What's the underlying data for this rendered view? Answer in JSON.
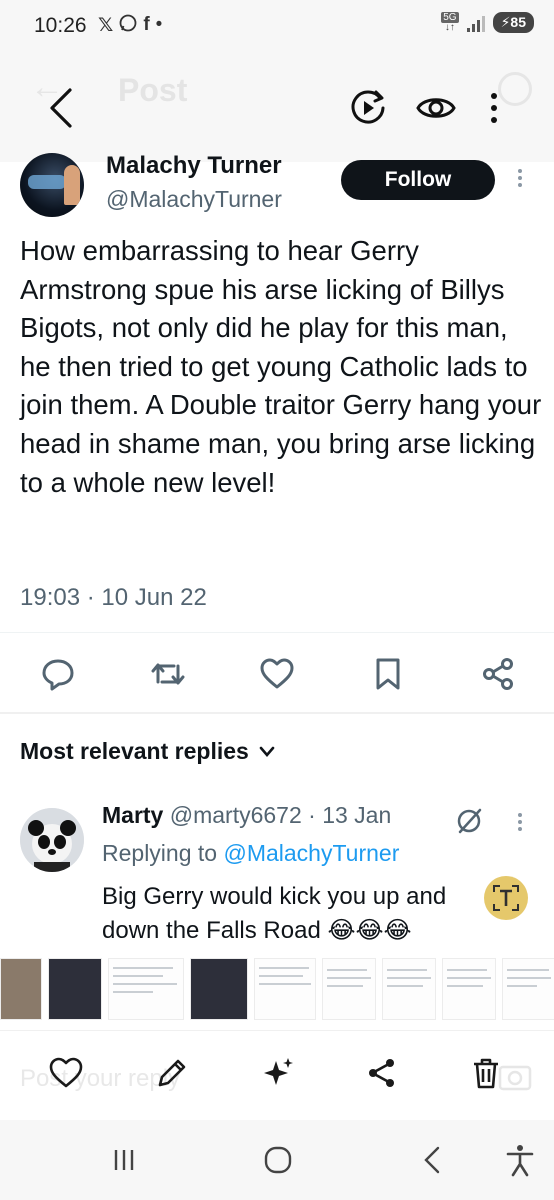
{
  "status_bar": {
    "time": "10:26",
    "left_icons": [
      "x-app-icon",
      "whatsapp-icon",
      "facebook-icon",
      "dot-icon"
    ],
    "network": "5G",
    "battery": "85"
  },
  "header": {
    "ghost_title": "Post"
  },
  "post": {
    "author_name": "Malachy Turner",
    "author_handle": "@MalachyTurner",
    "follow_label": "Follow",
    "text": "How embarrassing to hear Gerry Armstrong spue his arse licking of Billys Bigots, not only did he play for this man, he then tried to get young Catholic lads to join them. A Double traitor Gerry hang your head in shame man, you bring arse licking to a whole new level!",
    "timestamp": "19:03 · 10 Jun 22"
  },
  "replies_section": {
    "sort_label": "Most relevant replies"
  },
  "reply": {
    "name": "Marty",
    "handle": "@marty6672",
    "date": "· 13 Jan",
    "replying_prefix": "Replying to",
    "replying_to": "@MalachyTurner",
    "text": "Big Gerry would kick you up and down the Falls Road 😂😂😂"
  },
  "composer": {
    "placeholder": "Post your reply"
  },
  "colors": {
    "accent": "#1d9bf0",
    "text": "#0f1419",
    "muted": "#536471"
  }
}
